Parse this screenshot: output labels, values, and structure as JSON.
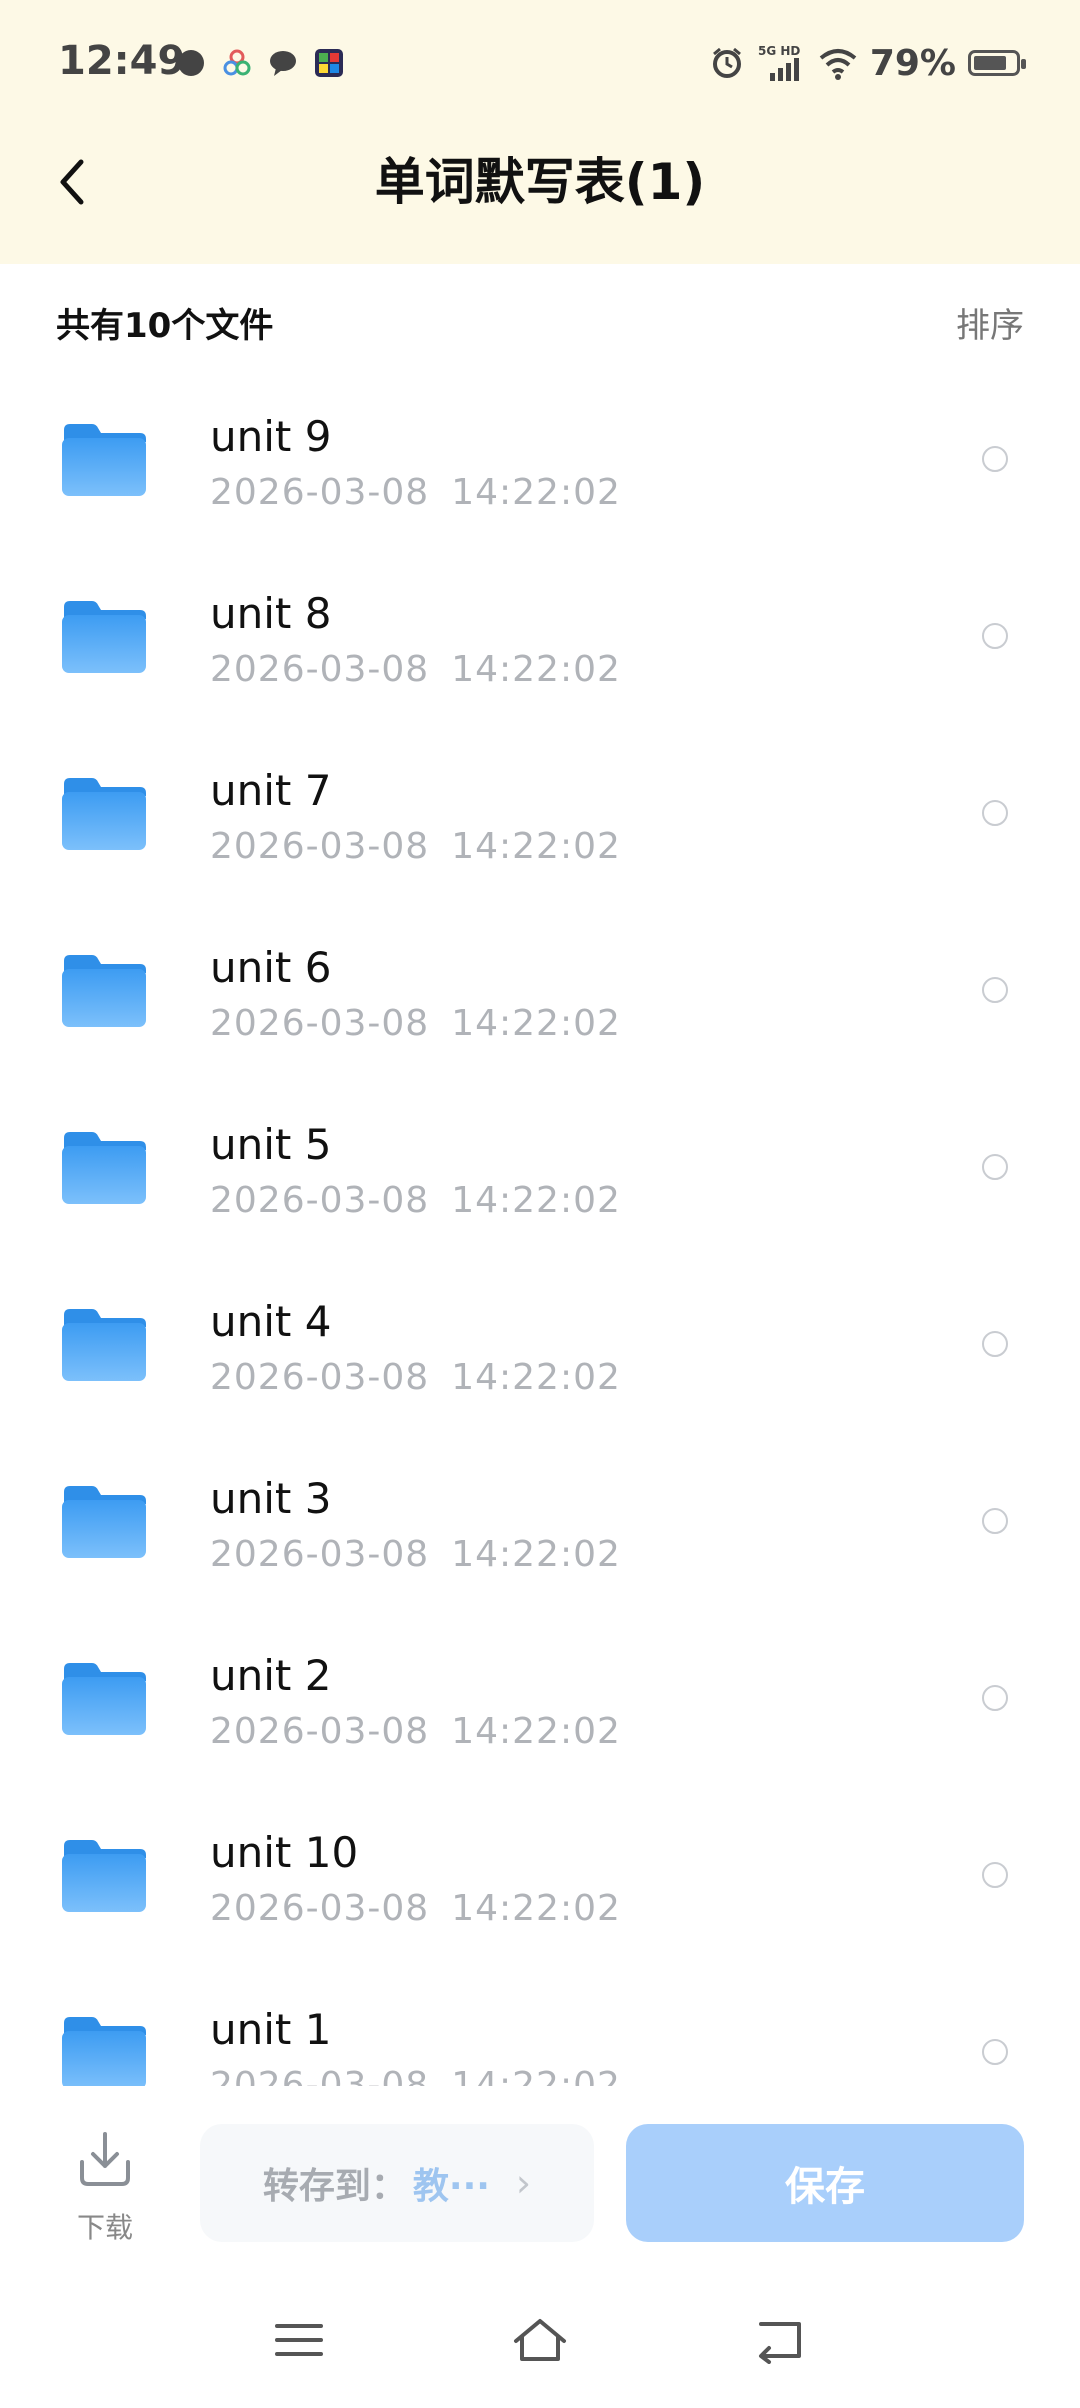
{
  "status_bar": {
    "time": "12:49",
    "network": "5G HD",
    "battery_percent": "79%",
    "battery_level": 0.79,
    "icons": [
      "record-dot-icon",
      "multicolor-app-icon",
      "chat-bubble-icon",
      "app-grid-icon",
      "alarm-icon",
      "signal-icon",
      "wifi-icon",
      "battery-icon"
    ]
  },
  "header": {
    "title": "单词默写表(1)",
    "back_icon": "chevron-left-icon"
  },
  "summary": {
    "count_text": "共有10个文件",
    "sort_label": "排序"
  },
  "files": [
    {
      "name": "unit 9",
      "date": "2026-03-08",
      "time": "14:22:02"
    },
    {
      "name": "unit 8",
      "date": "2026-03-08",
      "time": "14:22:02"
    },
    {
      "name": "unit 7",
      "date": "2026-03-08",
      "time": "14:22:02"
    },
    {
      "name": "unit 6",
      "date": "2026-03-08",
      "time": "14:22:02"
    },
    {
      "name": "unit 5",
      "date": "2026-03-08",
      "time": "14:22:02"
    },
    {
      "name": "unit 4",
      "date": "2026-03-08",
      "time": "14:22:02"
    },
    {
      "name": "unit 3",
      "date": "2026-03-08",
      "time": "14:22:02"
    },
    {
      "name": "unit 2",
      "date": "2026-03-08",
      "time": "14:22:02"
    },
    {
      "name": "unit 10",
      "date": "2026-03-08",
      "time": "14:22:02"
    },
    {
      "name": "unit 1",
      "date": "2026-03-08",
      "time": "14:22:02"
    }
  ],
  "actions": {
    "download_label": "下载",
    "saveto_label": "转存到：",
    "saveto_target": "教···",
    "save_label": "保存"
  },
  "colors": {
    "header_bg": "#fdf9e6",
    "folder_blue": "#4aa6f5",
    "save_button": "#a9cffb",
    "date_gray": "#b0b3b8"
  },
  "nav": {
    "icons": [
      "menu-icon",
      "home-icon",
      "back-icon"
    ]
  }
}
